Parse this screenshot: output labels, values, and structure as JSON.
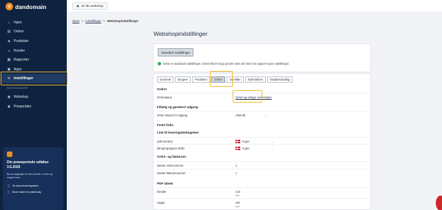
{
  "brand": {
    "name": "dandomain"
  },
  "sidebar": {
    "items": [
      {
        "label": "Hjem",
        "icon": "home-icon"
      },
      {
        "label": "Ordrer",
        "icon": "orders-icon"
      },
      {
        "label": "Produkter",
        "icon": "products-icon"
      },
      {
        "label": "Kunder",
        "icon": "customers-icon"
      },
      {
        "label": "Rapporter",
        "icon": "reports-icon"
      },
      {
        "label": "Apps",
        "icon": "apps-icon"
      },
      {
        "label": "Indstillinger",
        "icon": "settings-icon",
        "active": true
      }
    ],
    "section_label": "SALGSKANALER",
    "channels": [
      {
        "label": "Webshop",
        "icon": "webshop-icon"
      },
      {
        "label": "Prisportaler",
        "icon": "price-portal-icon"
      }
    ],
    "promo": {
      "title": "Din prøveperiode udløber 3.5.2025",
      "text": "Bevar adgangen til dine kunder, ordrer og meget mere.",
      "link1": "Se abonnementspakker",
      "link2": "Book møde om pakkevalg"
    }
  },
  "topbar": {
    "webshop_button": "Se din webshop"
  },
  "breadcrumb": {
    "home": "Hjem",
    "sep1": ">",
    "settings": "Indstillinger",
    "sep2": ">",
    "current": "Webshopindstillinger"
  },
  "page": {
    "title": "Webshopindstillinger"
  },
  "standard_card": {
    "button": "Standard Indstillinger",
    "note": "Dette er standard indstillinger. Disse bliver brugt på alle sites der ikke har angivet egne indstillinger."
  },
  "tabs": [
    {
      "label": "Generelt"
    },
    {
      "label": "Brugere"
    },
    {
      "label": "Produkter"
    },
    {
      "label": "Ordrer",
      "active": true
    },
    {
      "label": "Varelifter"
    },
    {
      "label": "Nyhedsbrev"
    },
    {
      "label": "Databehandling"
    }
  ],
  "orders": {
    "section_title": "Ordrer",
    "status_label": "Ordrestatus",
    "status_link": "Opret og rediger ordrestatus",
    "payment_title": "Fillælg og gavekort adgang",
    "payment_row_label": "Ordre status for adgang",
    "payment_row_value": "Afsendt",
    "fixed_links_title": "Faste links",
    "terms_title": "Link til levering­sbetingelser",
    "terms_rows": [
      {
        "label": "(alle kunder)",
        "value": "Ingen"
      },
      {
        "label": "(Brugergruppen B2B)",
        "value": "Ingen"
      }
    ],
    "numbers_title": "Ordre- og fakturanr.",
    "next_order_label": "Næste ordrenummer",
    "next_order_value": "1",
    "next_invoice_label": "Næste fakturanummer",
    "next_invoice_value": "1",
    "pdf_title": "PDF labels",
    "width_label": "Bredde",
    "width_value": "210",
    "width_unit": "mm",
    "height_label": "Højde",
    "height_value": "297",
    "height_unit": "mm"
  }
}
